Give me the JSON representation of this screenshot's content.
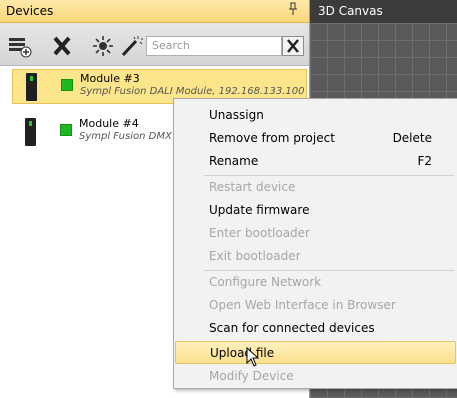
{
  "devices_panel": {
    "title": "Devices",
    "pin_glyph": "ᵖ",
    "toolbar": {
      "icons": [
        "add-device-icon",
        "remove-device-icon",
        "identify-light-icon",
        "magic-wand-icon"
      ],
      "search_placeholder": "Search"
    },
    "devices": [
      {
        "name": "Module #3",
        "subtitle": "Sympl Fusion DALI Module, 192.168.133.100",
        "status_color": "#20b820",
        "selected": true
      },
      {
        "name": "Module #4",
        "subtitle": "Sympl Fusion DMX",
        "status_color": "#20b820",
        "selected": false
      }
    ]
  },
  "canvas": {
    "title": "3D Canvas"
  },
  "context_menu": {
    "items": [
      {
        "label": "Unassign",
        "shortcut": "",
        "enabled": true
      },
      {
        "label": "Remove from project",
        "shortcut": "Delete",
        "enabled": true
      },
      {
        "label": "Rename",
        "shortcut": "F2",
        "enabled": true
      },
      {
        "label": "Restart device",
        "shortcut": "",
        "enabled": false
      },
      {
        "label": "Update firmware",
        "shortcut": "",
        "enabled": true
      },
      {
        "label": "Enter bootloader",
        "shortcut": "",
        "enabled": false
      },
      {
        "label": "Exit bootloader",
        "shortcut": "",
        "enabled": false
      },
      {
        "label": "Configure Network",
        "shortcut": "",
        "enabled": false
      },
      {
        "label": "Open Web Interface in Browser",
        "shortcut": "",
        "enabled": false
      },
      {
        "label": "Scan for connected devices",
        "shortcut": "",
        "enabled": true
      },
      {
        "label": "Upload file",
        "shortcut": "",
        "enabled": true,
        "highlighted": true
      },
      {
        "label": "Modify Device",
        "shortcut": "",
        "enabled": false
      }
    ]
  },
  "colors": {
    "panel_header": "#f8d77a",
    "selection": "#fce58a",
    "canvas_bg": "#5a5a5a",
    "status_ok": "#20b820"
  }
}
